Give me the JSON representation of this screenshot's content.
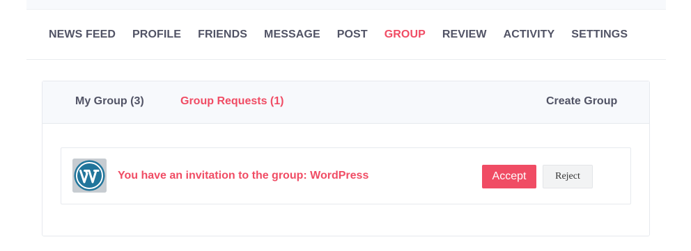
{
  "main_nav": {
    "items": [
      {
        "label": "NEWS FEED",
        "active": false
      },
      {
        "label": "PROFILE",
        "active": false
      },
      {
        "label": "FRIENDS",
        "active": false
      },
      {
        "label": "MESSAGE",
        "active": false
      },
      {
        "label": "POST",
        "active": false
      },
      {
        "label": "GROUP",
        "active": true
      },
      {
        "label": "REVIEW",
        "active": false
      },
      {
        "label": "ACTIVITY",
        "active": false
      },
      {
        "label": "SETTINGS",
        "active": false
      }
    ]
  },
  "group_tabs": {
    "my_group": "My Group (3)",
    "group_requests": "Group Requests (1)",
    "create_group": "Create Group",
    "active_tab": "group_requests"
  },
  "invitation": {
    "avatar_icon": "wordpress-logo-icon",
    "prefix": "You have an invitation to the group: ",
    "group_name": "WordPress",
    "accept_label": "Accept",
    "reject_label": "Reject"
  },
  "colors": {
    "accent": "#f04c64",
    "nav_text": "#515365",
    "tab_bar_bg": "#f7f9fc",
    "border": "#e6e9ee",
    "wordpress_blue": "#21759b"
  }
}
